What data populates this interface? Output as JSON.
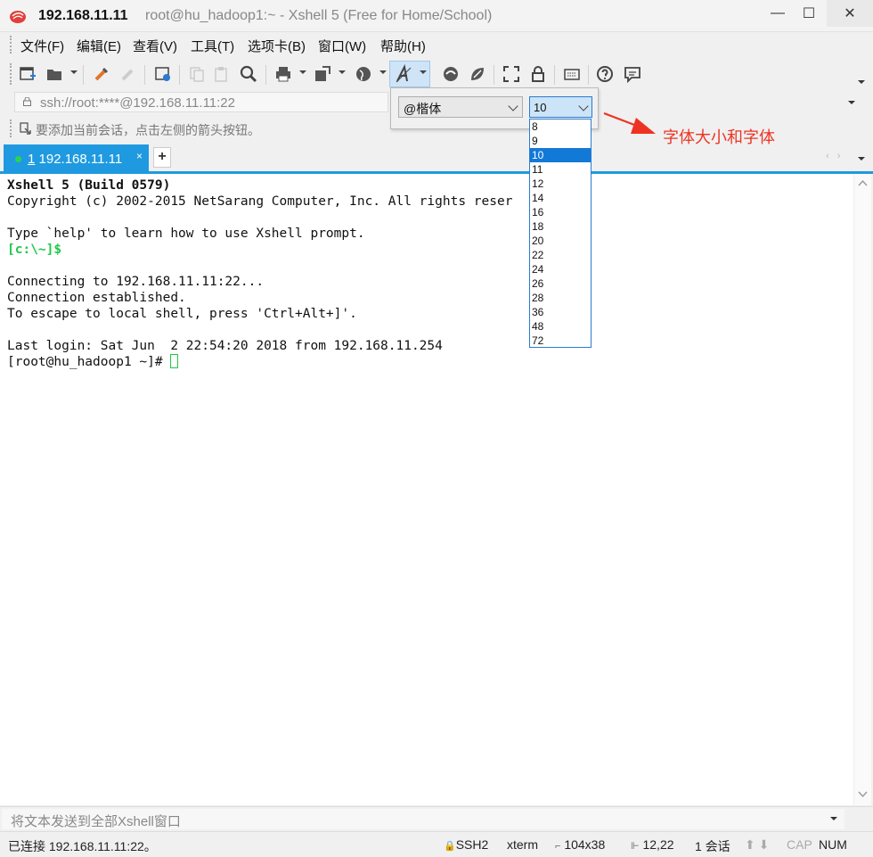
{
  "window": {
    "host": "192.168.11.11",
    "title": "root@hu_hadoop1:~ - Xshell 5 (Free for Home/School)",
    "minimize_glyph": "—",
    "maximize_glyph": "☐",
    "close_glyph": "✕"
  },
  "menu": {
    "items": [
      "文件(F)",
      "编辑(E)",
      "查看(V)",
      "工具(T)",
      "选项卡(B)",
      "窗口(W)",
      "帮助(H)"
    ]
  },
  "toolbar": {
    "icons": [
      "new-session-icon",
      "open-folder-icon",
      "reconnect-icon",
      "disconnect-icon",
      "properties-icon",
      "copy-icon",
      "paste-icon",
      "find-icon",
      "print-icon",
      "transfer-icon",
      "web-icon",
      "font-icon",
      "xftp-icon",
      "xmanager-icon",
      "fullscreen-icon",
      "lock-icon",
      "keyboard-icon",
      "help-icon",
      "chat-icon"
    ]
  },
  "address": {
    "value": "ssh://root:****@192.168.11.11:22"
  },
  "hint": {
    "text": "要添加当前会话，点击左侧的箭头按钮。"
  },
  "tabs": [
    {
      "number": "1",
      "label": "192.168.11.11",
      "close_glyph": "×",
      "active": true
    }
  ],
  "tab_add_glyph": "+",
  "tab_nav_glyph": "‹ ›",
  "terminal": {
    "lines": [
      {
        "text": "Xshell 5 (Build 0579)",
        "style": "bold"
      },
      {
        "text": "Copyright (c) 2002-2015 NetSarang Computer, Inc. All rights reser",
        "style": "normal"
      },
      {
        "text": "",
        "style": "normal"
      },
      {
        "text": "Type `help' to learn how to use Xshell prompt.",
        "style": "normal"
      },
      {
        "text": "[c:\\~]$",
        "style": "green"
      },
      {
        "text": "",
        "style": "normal"
      },
      {
        "text": "Connecting to 192.168.11.11:22...",
        "style": "normal"
      },
      {
        "text": "Connection established.",
        "style": "normal"
      },
      {
        "text": "To escape to local shell, press 'Ctrl+Alt+]'.",
        "style": "normal"
      },
      {
        "text": "",
        "style": "normal"
      },
      {
        "text": "Last login: Sat Jun  2 22:54:20 2018 from 192.168.11.254",
        "style": "normal"
      },
      {
        "text": "[root@hu_hadoop1 ~]# ",
        "style": "prompt"
      }
    ]
  },
  "font_popup": {
    "font_value": "@楷体",
    "size_value": "10",
    "size_options": [
      "8",
      "9",
      "10",
      "11",
      "12",
      "14",
      "16",
      "18",
      "20",
      "22",
      "24",
      "26",
      "28",
      "36",
      "48",
      "72"
    ],
    "selected_size": "10"
  },
  "annotation": {
    "text": "字体大小和字体",
    "color": "#ee3322"
  },
  "compose": {
    "placeholder": "将文本发送到全部Xshell窗口"
  },
  "status": {
    "connection": "已连接 192.168.11.11:22。",
    "protocol": "SSH2",
    "terminal_type": "xterm",
    "size": "104x38",
    "cursor_pos": "12,22",
    "sessions": "1 会话",
    "caps": "CAP",
    "num": "NUM"
  },
  "colors": {
    "tab_accent": "#1f9ae0",
    "prompt_green": "#1ec94a",
    "selection_blue": "#1379d7"
  }
}
